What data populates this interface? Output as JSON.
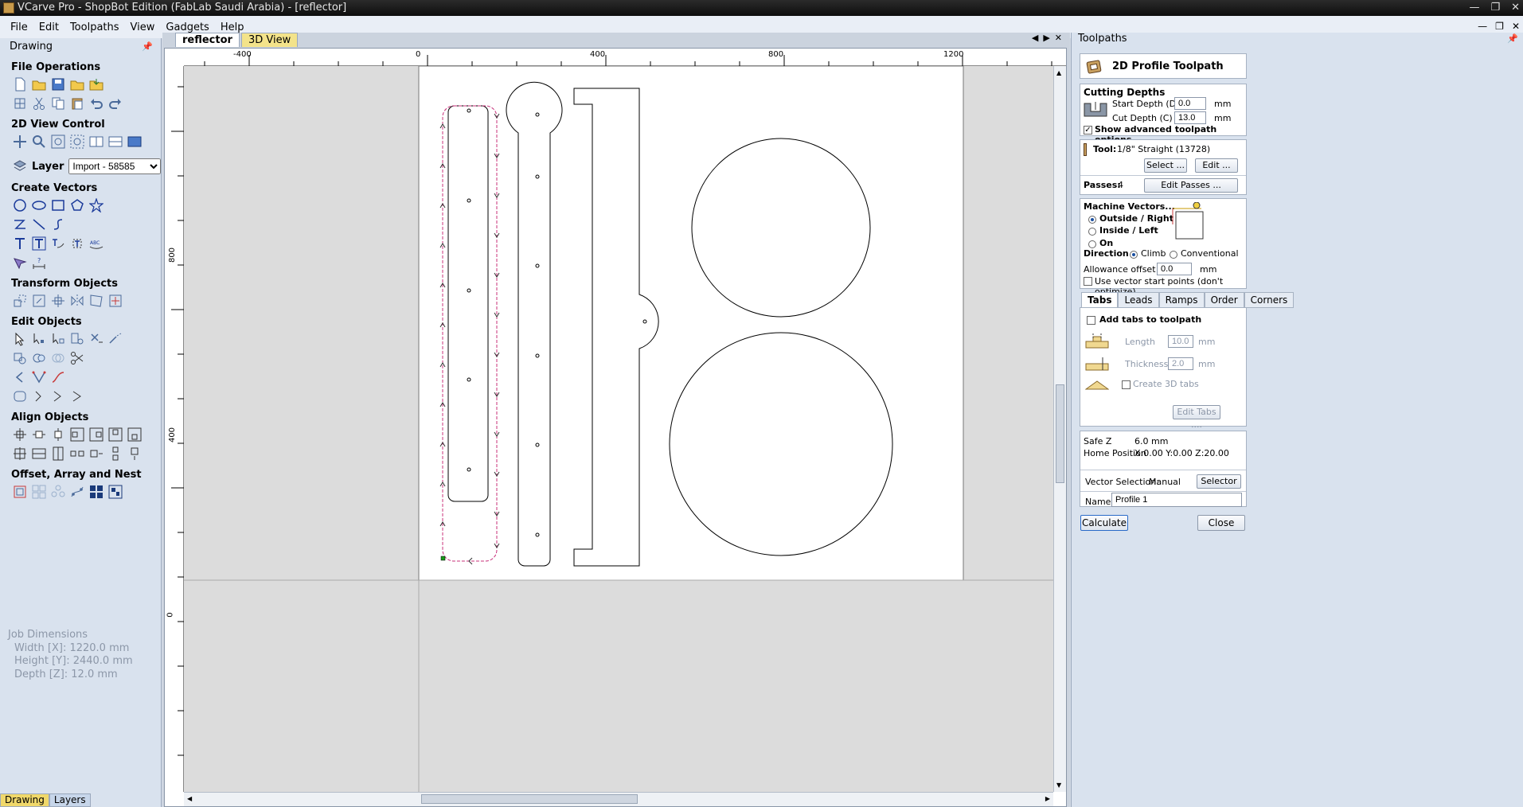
{
  "window": {
    "title": "VCarve Pro - ShopBot Edition (FabLab Saudi Arabia) - [reflector]"
  },
  "menu": {
    "items": [
      "File",
      "Edit",
      "Toolpaths",
      "View",
      "Gadgets",
      "Help"
    ]
  },
  "left_panel": {
    "title": "Drawing",
    "file_operations": "File Operations",
    "view_control": "2D View Control",
    "layer_label": "Layer",
    "layer_value": "Import - 58585",
    "create_vectors": "Create Vectors",
    "transform_objects": "Transform Objects",
    "edit_objects": "Edit Objects",
    "align_objects": "Align Objects",
    "offset_array": "Offset, Array and Nest",
    "job_dims": {
      "title": "Job Dimensions",
      "width": "Width  [X]: 1220.0 mm",
      "height": "Height [Y]: 2440.0 mm",
      "depth": "Depth  [Z]: 12.0 mm"
    },
    "bottom_tabs": [
      "Drawing",
      "Layers"
    ]
  },
  "document": {
    "tabs": [
      "reflector",
      "3D View"
    ],
    "ruler_top": [
      "-400",
      "0",
      "400",
      "800",
      "1200"
    ],
    "ruler_left": [
      "800",
      "400",
      "0"
    ]
  },
  "toolpaths_panel": {
    "title": "Toolpaths",
    "header": "2D Profile Toolpath",
    "cutting_depths": "Cutting Depths",
    "start_depth_label": "Start Depth (D)",
    "start_depth_value": "0.0",
    "cut_depth_label": "Cut Depth (C)",
    "cut_depth_value": "13.0",
    "unit": "mm",
    "show_advanced": "Show advanced toolpath options",
    "tool_label": "Tool:",
    "tool_value": "1/8\" Straight (13728)",
    "select_btn": "Select ...",
    "edit_btn": "Edit ...",
    "passes_label": "Passes:",
    "passes_value": "4",
    "edit_passes_btn": "Edit Passes ...",
    "machine_vectors": "Machine Vectors...",
    "outside": "Outside / Right",
    "inside": "Inside / Left",
    "on": "On",
    "direction": "Direction",
    "climb": "Climb",
    "conventional": "Conventional",
    "allowance_label": "Allowance offset",
    "allowance_value": "0.0",
    "use_vector_start": "Use vector start points (don't optimize)",
    "subtabs": [
      "Tabs",
      "Leads",
      "Ramps",
      "Order",
      "Corners"
    ],
    "add_tabs": "Add tabs to toolpath",
    "length_label": "Length",
    "length_value": "10.0",
    "thickness_label": "Thickness",
    "thickness_value": "2.0",
    "create_3d_tabs": "Create 3D tabs",
    "edit_tabs_btn": "Edit Tabs ....",
    "safe_z_label": "Safe Z",
    "safe_z_value": "6.0 mm",
    "home_label": "Home Position",
    "home_value": "X:0.00 Y:0.00 Z:20.00",
    "vector_selection_label": "Vector Selection:",
    "vector_selection_value": "Manual",
    "selector_btn": "Selector ...",
    "name_label": "Name:",
    "name_value": "Profile 1",
    "calculate_btn": "Calculate",
    "close_btn": "Close"
  }
}
